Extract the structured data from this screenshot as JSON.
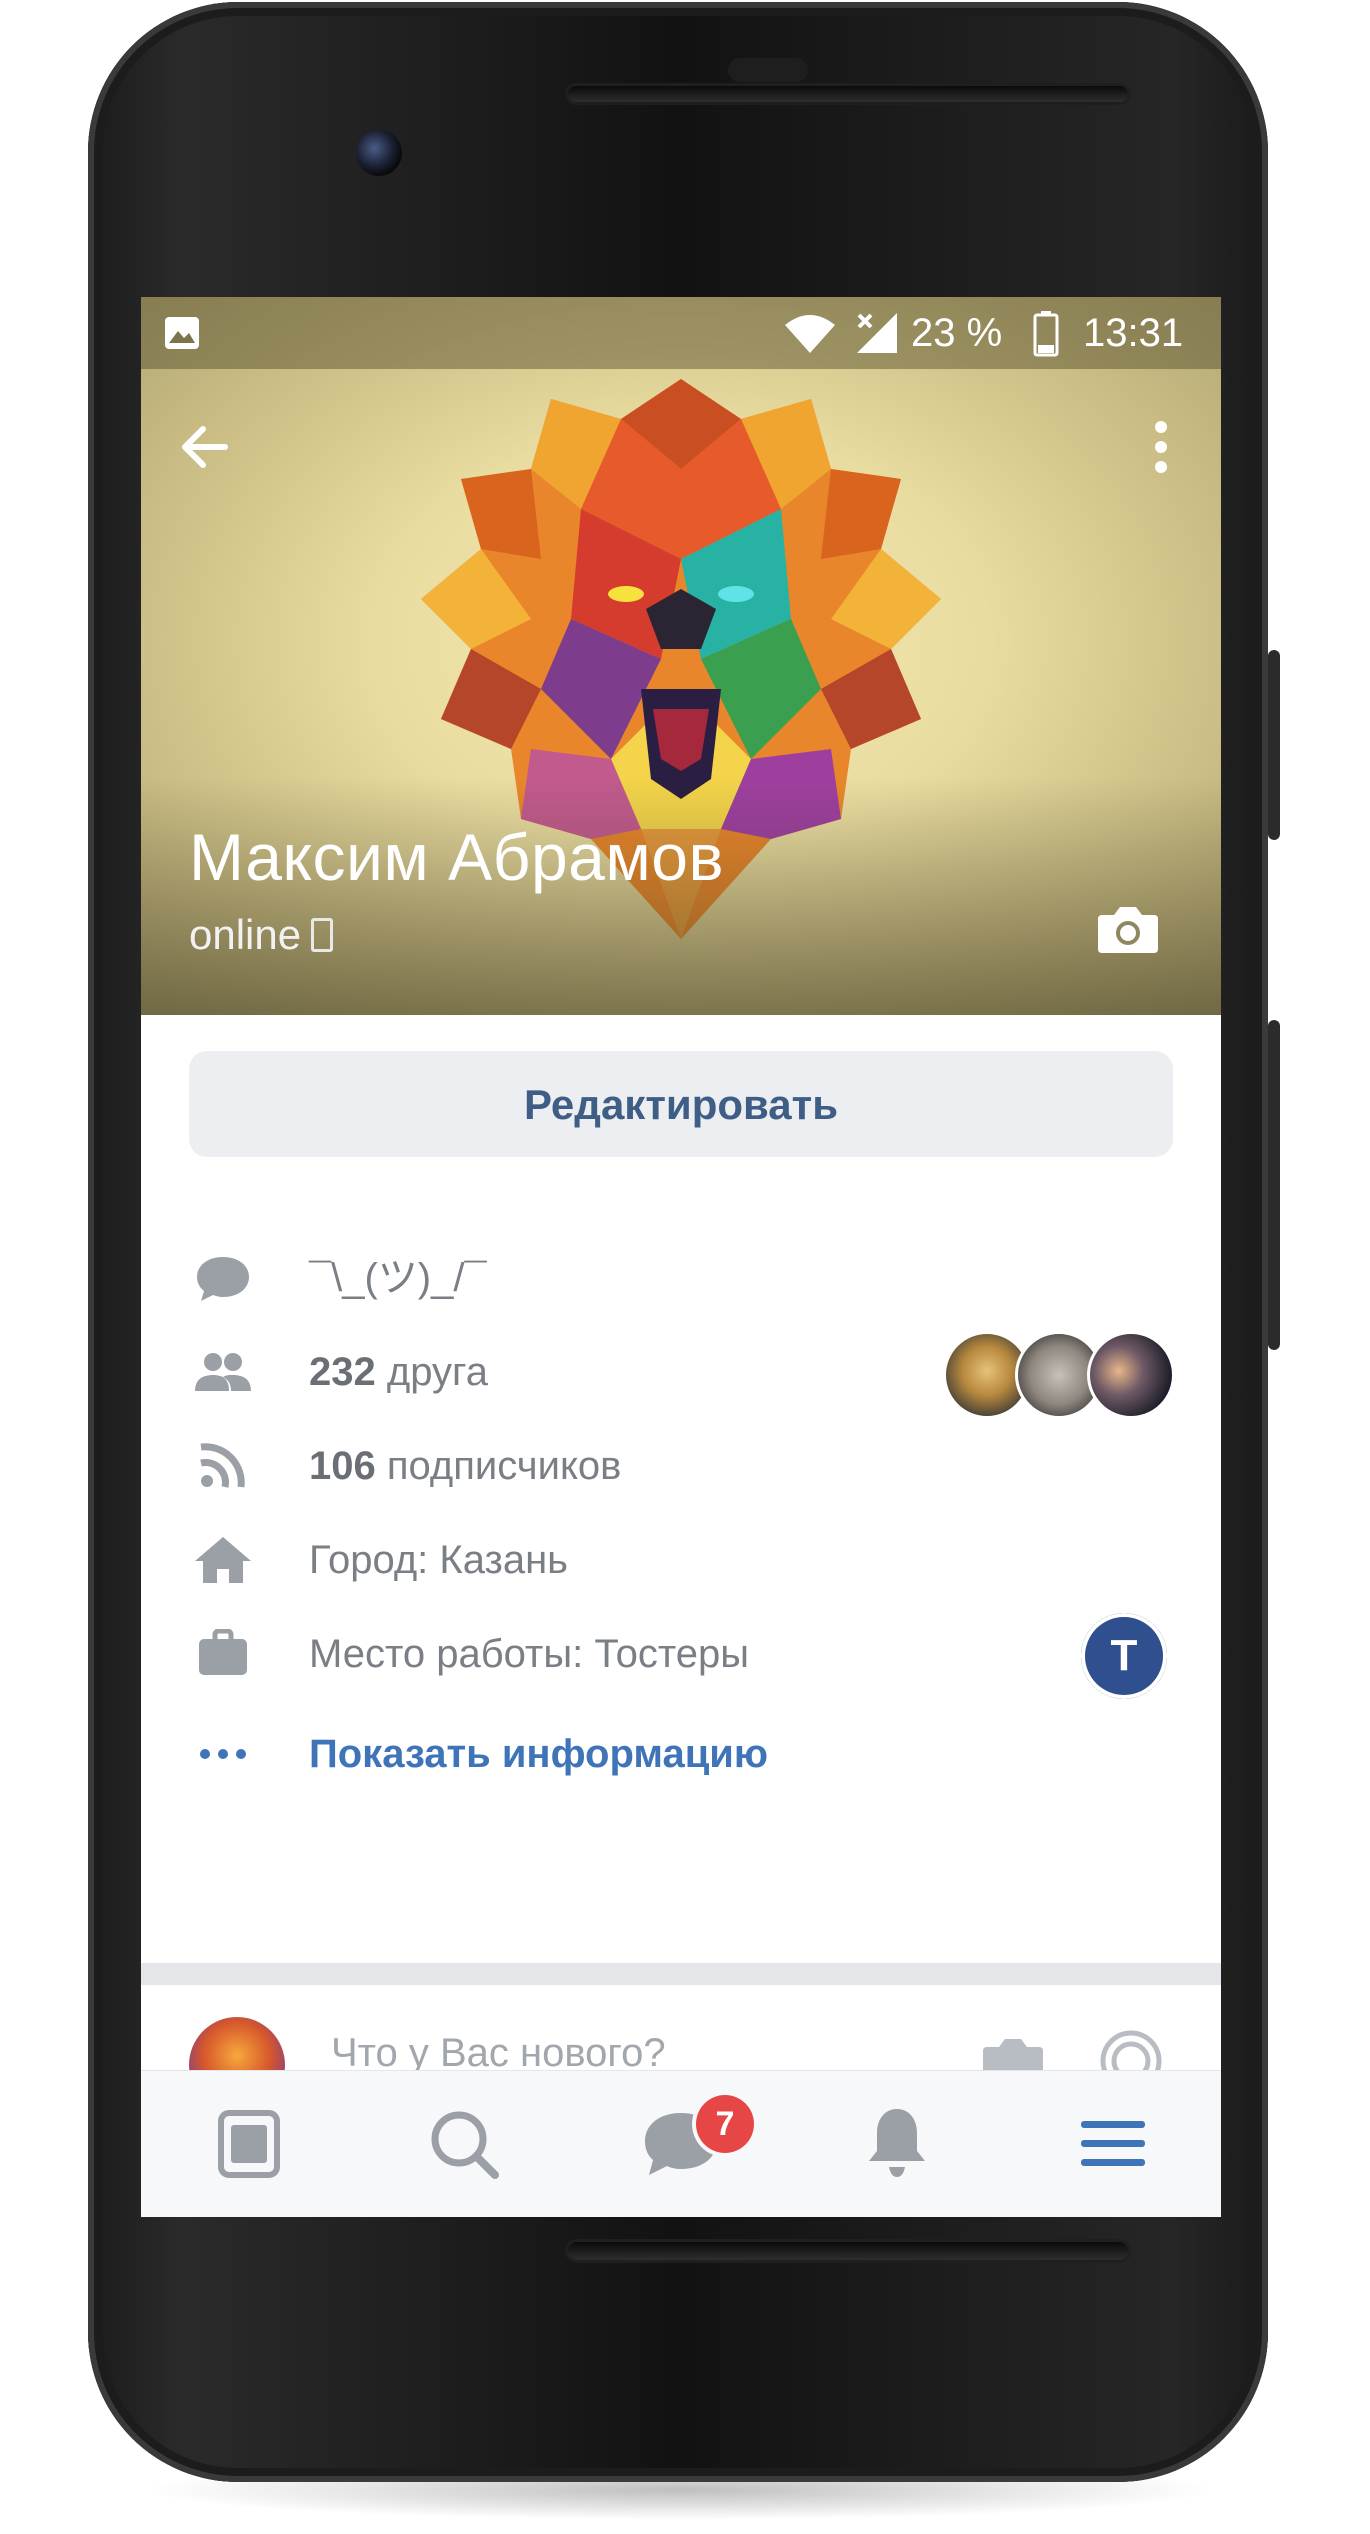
{
  "statusbar": {
    "battery": "23 %",
    "time": "13:31"
  },
  "profile": {
    "name": "Максим Абрамов",
    "status": "online"
  },
  "actions": {
    "edit_label": "Редактировать"
  },
  "info": {
    "status_text": "¯\\_(ツ)_/¯",
    "friends_count": "232",
    "friends_label": " друга",
    "followers_count": "106",
    "followers_label": " подписчиков",
    "city": "Город: Казань",
    "work": "Место работы: Тостеры",
    "work_logo_letter": "T",
    "show_more": "Показать информацию"
  },
  "compose": {
    "placeholder": "Что у Вас нового?"
  },
  "tabbar": {
    "messages_badge": "7"
  },
  "colors": {
    "accent": "#3f74b8",
    "button_text": "#3f5e86",
    "badge": "#e64646"
  }
}
